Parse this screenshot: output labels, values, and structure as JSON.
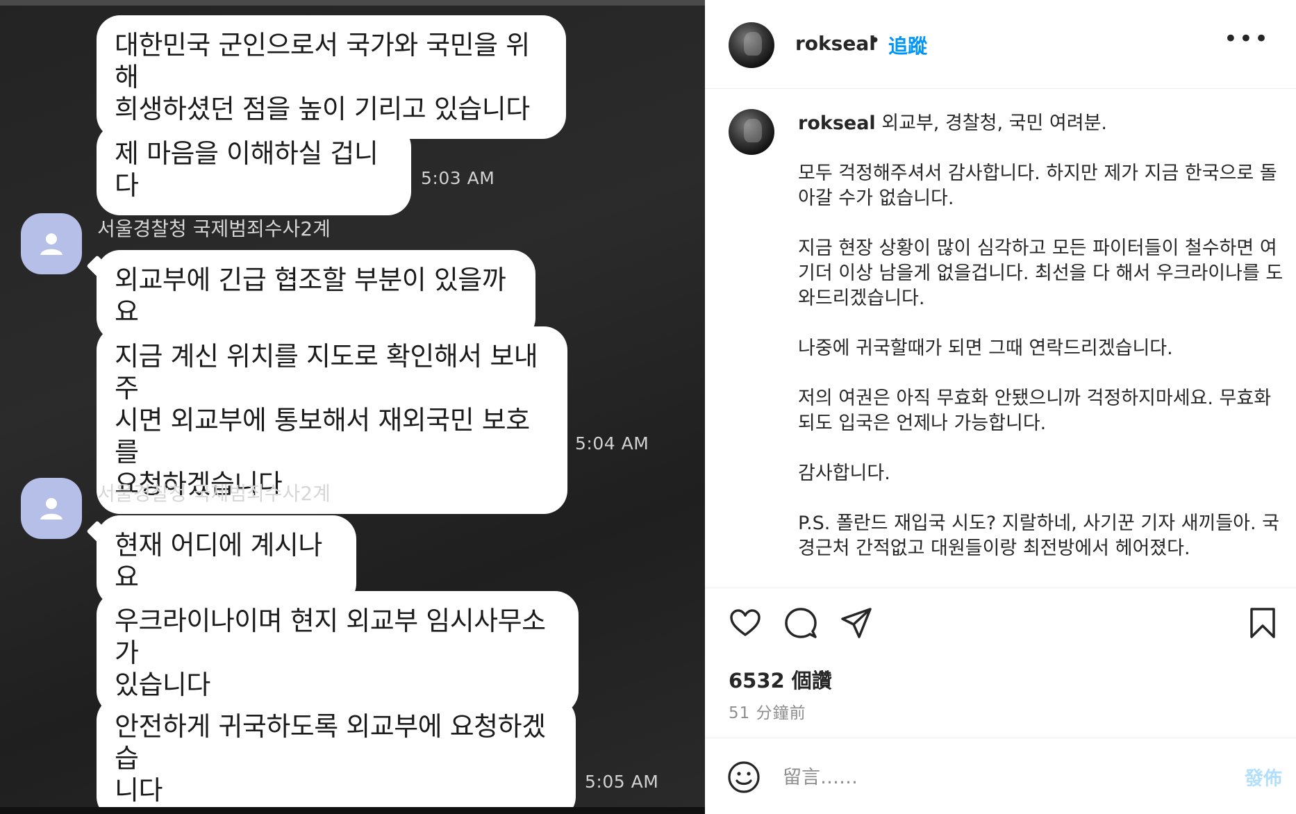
{
  "chat": {
    "messages": [
      {
        "text": "대한민국 군인으로서 국가와 국민을 위해\n희생하셨던 점을 높이 기리고 있습니다"
      },
      {
        "text": "제 마음을 이해하실 겁니다",
        "time": "5:03 AM"
      },
      {
        "sender": "서울경찰청 국제범죄수사2계"
      },
      {
        "text": "외교부에 긴급 협조할 부분이 있을까요"
      },
      {
        "text": "지금 계신 위치를 지도로 확인해서 보내주\n시면 외교부에 통보해서 재외국민 보호를\n요청하겠습니다",
        "time": "5:04 AM"
      },
      {
        "sender": "서울경찰청 국제범죄수사2계"
      },
      {
        "text": "현재 어디에 계시나요"
      },
      {
        "text": "우크라이나이며 현지 외교부 임시사무소가\n있습니다"
      },
      {
        "text": "안전하게 귀국하도록 외교부에 요청하겠습\n니다",
        "time": "5:05 AM"
      }
    ],
    "avatar_icon": "person-icon",
    "avatar_color": "#b6bfe8"
  },
  "post": {
    "header": {
      "username": "rokseal",
      "separator": "•",
      "follow_label": "追蹤",
      "more_label": "•••"
    },
    "caption": {
      "username": "rokseal",
      "first_line": "외교부, 경찰청, 국민 여려분.",
      "paragraphs": [
        "모두 걱정해주셔서 감사합니다. 하지만 제가 지금 한국으로 돌아갈 수가 없습니다.",
        "지금 현장 상황이 많이 심각하고 모든 파이터들이 철수하면 여기더 이상 남을게 없을겁니다. 최선을 다 해서 우크라이나를 도와드리겠습니다.",
        "나중에 귀국할때가 되면 그때 연락드리겠습니다.",
        "저의 여권은 아직 무효화 안됐으니까 걱정하지마세요. 무효화되도 입국은 언제나 가능합니다.",
        "감사합니다.",
        "P.S. 폴란드 재입국 시도? 지랄하네, 사기꾼 기자 새끼들아. 국경근처 간적없고 대원들이랑 최전방에서 헤어졌다."
      ]
    },
    "likes": "6532 個讚",
    "time_ago": "51 分鐘前",
    "comment": {
      "placeholder": "留言……",
      "post_label": "發佈"
    },
    "colors": {
      "accent": "#0095f6",
      "post_disabled": "#b2dffc"
    }
  }
}
